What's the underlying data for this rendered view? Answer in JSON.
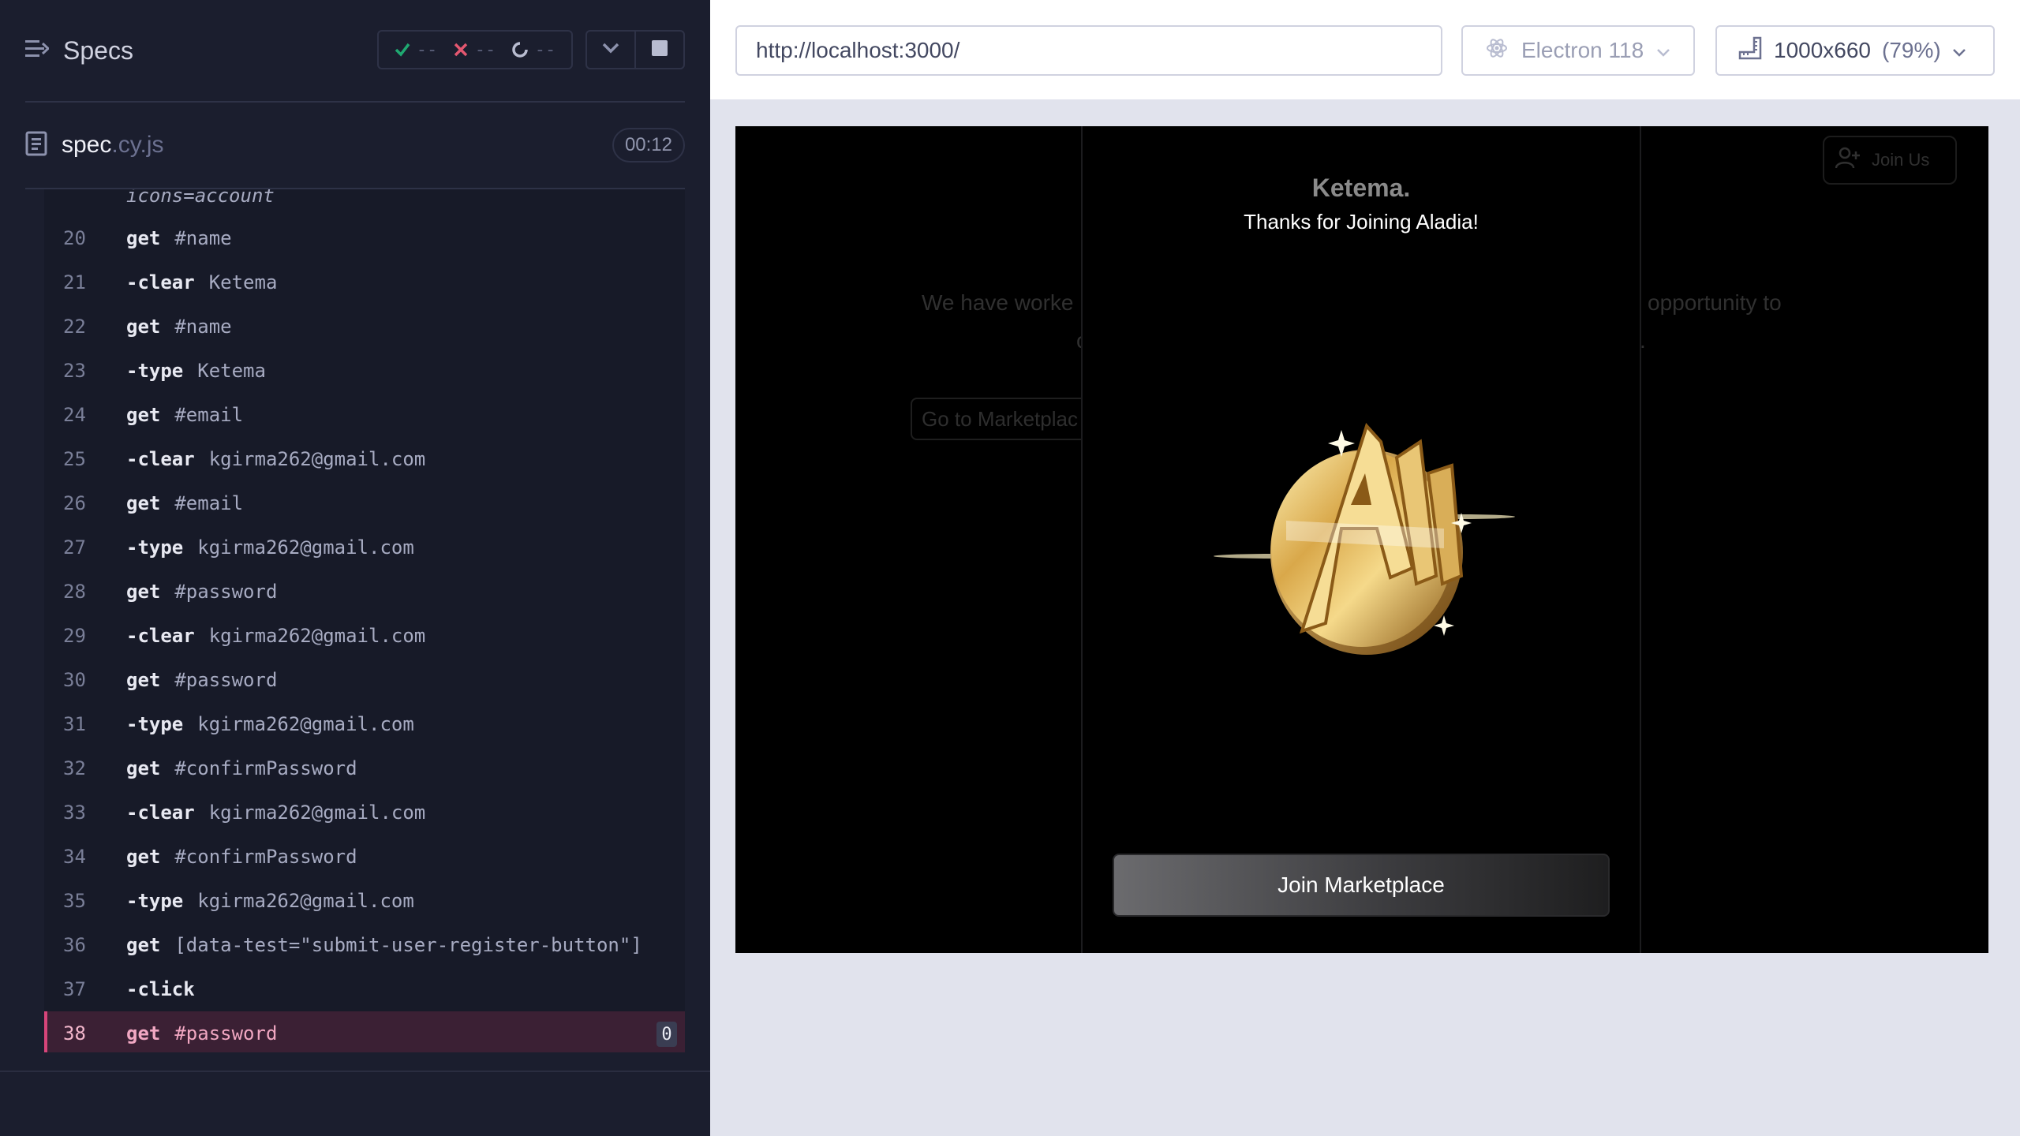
{
  "runner": {
    "specs_label": "Specs",
    "passed": "--",
    "failed": "--",
    "pending": "--",
    "spec_name": "spec",
    "spec_ext": ".cy.js",
    "timer": "00:12",
    "partial_line": "icons=account",
    "commands": [
      {
        "num": "20",
        "name": "get",
        "arg": "#name",
        "child": false
      },
      {
        "num": "21",
        "name": "-clear",
        "arg": "Ketema",
        "child": true
      },
      {
        "num": "22",
        "name": "get",
        "arg": "#name",
        "child": false
      },
      {
        "num": "23",
        "name": "-type",
        "arg": "Ketema",
        "child": true
      },
      {
        "num": "24",
        "name": "get",
        "arg": "#email",
        "child": false
      },
      {
        "num": "25",
        "name": "-clear",
        "arg": "kgirma262@gmail.com",
        "child": true
      },
      {
        "num": "26",
        "name": "get",
        "arg": "#email",
        "child": false
      },
      {
        "num": "27",
        "name": "-type",
        "arg": "kgirma262@gmail.com",
        "child": true
      },
      {
        "num": "28",
        "name": "get",
        "arg": "#password",
        "child": false
      },
      {
        "num": "29",
        "name": "-clear",
        "arg": "kgirma262@gmail.com",
        "child": true
      },
      {
        "num": "30",
        "name": "get",
        "arg": "#password",
        "child": false
      },
      {
        "num": "31",
        "name": "-type",
        "arg": "kgirma262@gmail.com",
        "child": true
      },
      {
        "num": "32",
        "name": "get",
        "arg": "#confirmPassword",
        "child": false
      },
      {
        "num": "33",
        "name": "-clear",
        "arg": "kgirma262@gmail.com",
        "child": true
      },
      {
        "num": "34",
        "name": "get",
        "arg": "#confirmPassword",
        "child": false
      },
      {
        "num": "35",
        "name": "-type",
        "arg": "kgirma262@gmail.com",
        "child": true
      },
      {
        "num": "36",
        "name": "get",
        "arg": "[data-test=\"submit-user-register-button\"]",
        "child": false
      },
      {
        "num": "37",
        "name": "-click",
        "arg": "",
        "child": true
      },
      {
        "num": "38",
        "name": "get",
        "arg": "#password",
        "child": false,
        "active": true,
        "count": "0"
      }
    ]
  },
  "browser": {
    "url": "http://localhost:3000/",
    "browser_name": "Electron 118",
    "viewport": "1000x660",
    "scale": "(79%)"
  },
  "app": {
    "bg_join_label": "Join Us",
    "bg_text_left": "We have worke",
    "bg_text_right": "opportunity to",
    "bg_text_left2": "c",
    "bg_text_right2": ".",
    "bg_goto_label": "Go to Marketplac",
    "modal_brand": "Ketema.",
    "modal_subtitle": "Thanks for Joining Aladia!",
    "join_button_label": "Join Marketplace"
  },
  "colors": {
    "runner_bg": "#1b1e2e",
    "active_row": "#3b2034",
    "active_accent": "#d6457a",
    "pass": "#1fa971",
    "fail": "#e45770"
  }
}
